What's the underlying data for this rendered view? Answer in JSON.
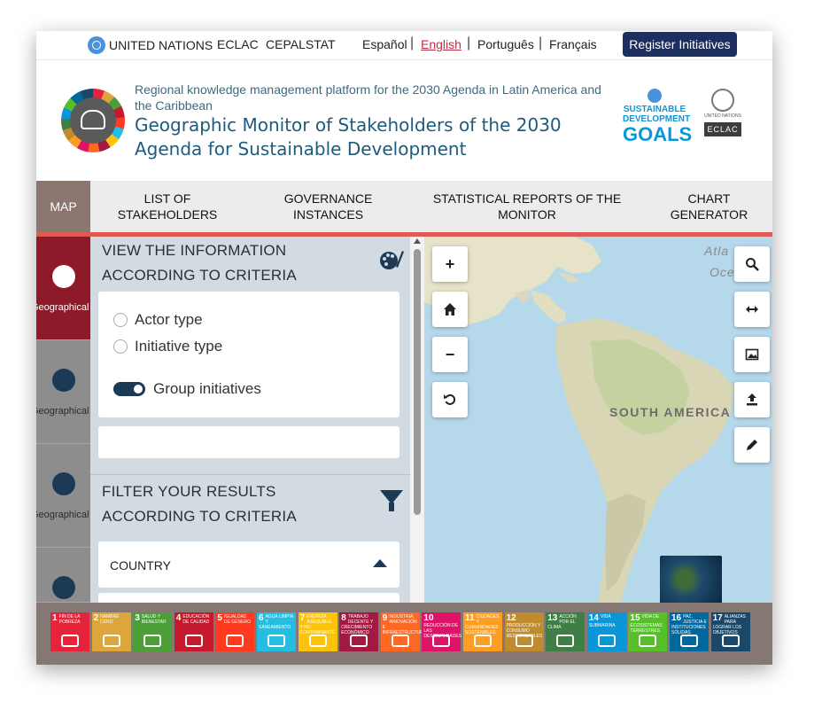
{
  "topbar": {
    "un_label": "UNITED NATIONS",
    "eclac": "ECLAC",
    "cepalstat": "CEPALSTAT",
    "languages": [
      "Español",
      "English",
      "Português",
      "Français"
    ],
    "active_language": "English",
    "register_button": "Register Initiatives"
  },
  "header": {
    "subtitle": "Regional knowledge management platform for the 2030 Agenda in Latin America and the Caribbean",
    "title": "Geographic Monitor of Stakeholders of the 2030 Agenda for Sustainable Development",
    "sdg_logo": {
      "line1": "SUSTAINABLE",
      "line2": "DEVELOPMENT",
      "goals": "GOALS"
    },
    "eclac_logo": {
      "un_text": "UNITED NATIONS",
      "box_text": "ECLAC"
    }
  },
  "nav": {
    "tabs": [
      {
        "label": "MAP"
      },
      {
        "label": "LIST OF STAKEHOLDERS"
      },
      {
        "label": "GOVERNANCE INSTANCES"
      },
      {
        "label": "STATISTICAL REPORTS OF THE MONITOR"
      },
      {
        "label": "CHART GENERATOR"
      }
    ],
    "active": "MAP"
  },
  "sidebar_icons": [
    {
      "label": "Geographical layers",
      "icon": "map-pin-icon",
      "active": true
    },
    {
      "label": "Geographical layers",
      "icon": "map-pin-icon",
      "active": false
    },
    {
      "label": "Geographical layers",
      "icon": "layers-icon",
      "active": false
    },
    {
      "label": "",
      "icon": "chart-icon",
      "active": false
    }
  ],
  "panel": {
    "view_heading_line1": "VIEW THE INFORMATION",
    "view_heading_line2": "ACCORDING TO CRITERIA",
    "options": [
      {
        "label": "Actor type",
        "selected": false
      },
      {
        "label": "Initiative type",
        "selected": false
      }
    ],
    "group_toggle": {
      "label": "Group initiatives",
      "on": true
    },
    "filter_heading_line1": "FILTER YOUR RESULTS",
    "filter_heading_line2": "ACCORDING TO CRITERIA",
    "country_label": "COUNTRY"
  },
  "map": {
    "labels": {
      "atlantic1": "Atla",
      "atlantic2": "Oce",
      "south_america": "SOUTH AMERICA"
    },
    "left_controls": [
      "+",
      "home",
      "−",
      "refresh"
    ],
    "right_controls": [
      "search",
      "swap",
      "image",
      "upload",
      "edit"
    ]
  },
  "sdg_goals": [
    {
      "n": "1",
      "text": "FIN DE LA POBREZA",
      "color": "#e5243b"
    },
    {
      "n": "2",
      "text": "HAMBRE CERO",
      "color": "#dda63a"
    },
    {
      "n": "3",
      "text": "SALUD Y BIENESTAR",
      "color": "#4c9f38"
    },
    {
      "n": "4",
      "text": "EDUCACIÓN DE CALIDAD",
      "color": "#c5192d"
    },
    {
      "n": "5",
      "text": "IGUALDAD DE GÉNERO",
      "color": "#ff3a21"
    },
    {
      "n": "6",
      "text": "AGUA LIMPIA Y SANEAMIENTO",
      "color": "#26bde2"
    },
    {
      "n": "7",
      "text": "ENERGÍA ASEQUIBLE Y NO CONTAMINANTE",
      "color": "#fcc30b"
    },
    {
      "n": "8",
      "text": "TRABAJO DECENTE Y CRECIMIENTO ECONÓMICO",
      "color": "#a21942"
    },
    {
      "n": "9",
      "text": "INDUSTRIA, INNOVACIÓN E INFRAESTRUCTURA",
      "color": "#fd6925"
    },
    {
      "n": "10",
      "text": "REDUCCIÓN DE LAS DESIGUALDADES",
      "color": "#dd1367"
    },
    {
      "n": "11",
      "text": "CIUDADES Y COMUNIDADES SOSTENIBLES",
      "color": "#fd9d24"
    },
    {
      "n": "12",
      "text": "PRODUCCIÓN Y CONSUMO RESPONSABLES",
      "color": "#bf8b2e"
    },
    {
      "n": "13",
      "text": "ACCIÓN POR EL CLIMA",
      "color": "#3f7e44"
    },
    {
      "n": "14",
      "text": "VIDA SUBMARINA",
      "color": "#0a97d9"
    },
    {
      "n": "15",
      "text": "VIDA DE ECOSISTEMAS TERRESTRES",
      "color": "#56c02b"
    },
    {
      "n": "16",
      "text": "PAZ, JUSTICIA E INSTITUCIONES SÓLIDAS",
      "color": "#00689d"
    },
    {
      "n": "17",
      "text": "ALIANZAS PARA LOGRAR LOS OBJETIVOS",
      "color": "#19486a"
    }
  ]
}
